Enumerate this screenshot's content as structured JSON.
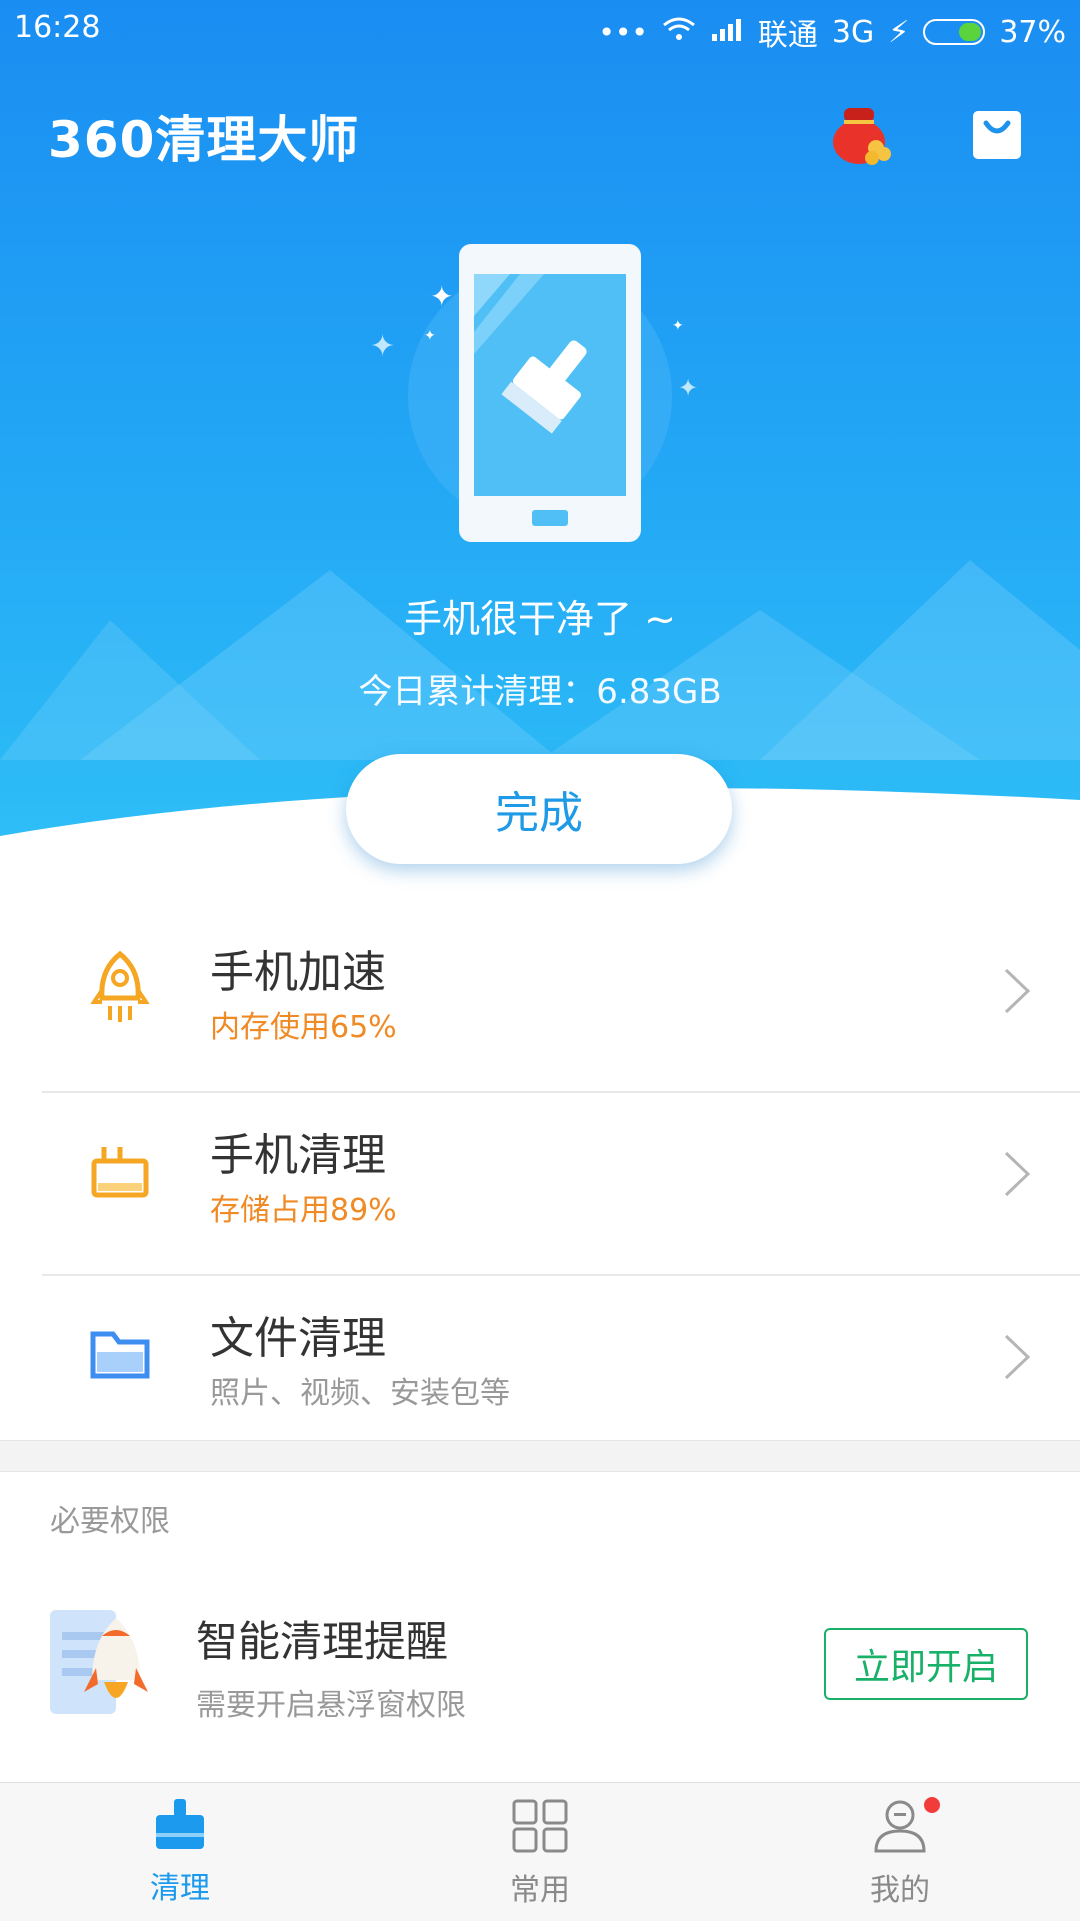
{
  "status_bar": {
    "time": "16:28",
    "carrier": "联通",
    "network": "3G",
    "battery": "37%"
  },
  "header": {
    "brand": "360清理大师",
    "icons": [
      "red-envelope-icon",
      "shopping-bag-icon"
    ]
  },
  "hero": {
    "status": "手机很干净了 ~",
    "total_cleaned": "今日累计清理：6.83GB",
    "done_button": "完成"
  },
  "colors": {
    "accent": "#1a8df2",
    "orange": "#f08a24",
    "green": "#19b068",
    "muted": "#999999"
  },
  "features": [
    {
      "title": "手机加速",
      "subtitle": "内存使用65%",
      "icon": "rocket-icon"
    },
    {
      "title": "手机清理",
      "subtitle": "存储占用89%",
      "icon": "broom-icon"
    },
    {
      "title": "文件清理",
      "subtitle": "照片、视频、安装包等",
      "icon": "folder-icon"
    }
  ],
  "permissions": {
    "heading": "必要权限",
    "item": {
      "title": "智能清理提醒",
      "subtitle": "需要开启悬浮窗权限",
      "button": "立即开启",
      "icon": "rocket-phone-icon"
    }
  },
  "tabs": [
    {
      "label": "清理",
      "icon": "broom-tab-icon",
      "active": true
    },
    {
      "label": "常用",
      "icon": "grid-icon",
      "active": false
    },
    {
      "label": "我的",
      "icon": "user-icon",
      "active": false,
      "badge": true
    }
  ]
}
